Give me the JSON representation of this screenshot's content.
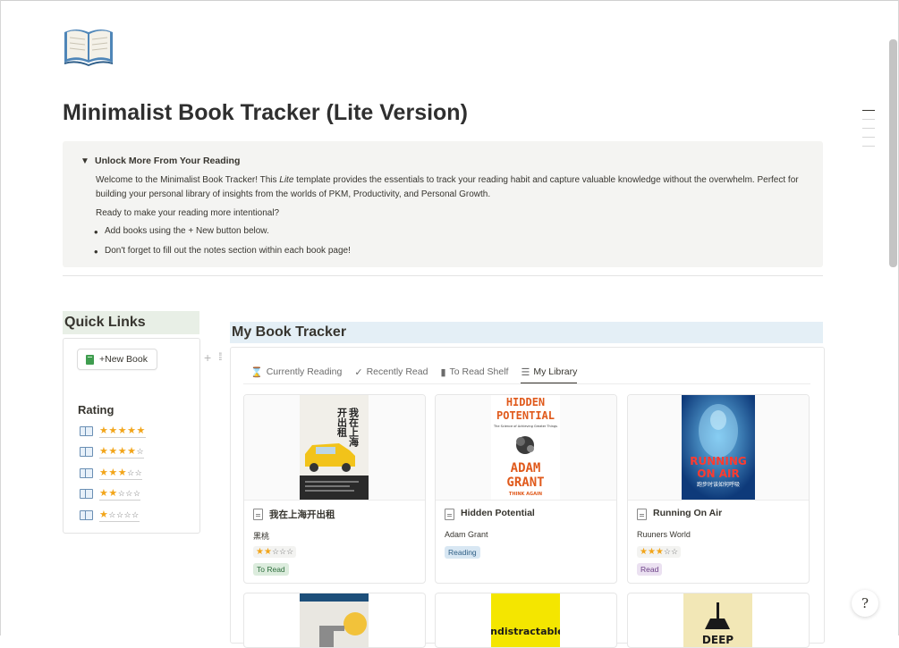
{
  "page": {
    "title": "Minimalist Book Tracker (Lite Version)",
    "icon": "open-book-icon"
  },
  "callout": {
    "toggle_label": "Unlock More From Your Reading",
    "intro_before_italic": "Welcome to the Minimalist Book Tracker! This ",
    "intro_italic": "Lite",
    "intro_after_italic": " template provides the essentials to track your reading habit and capture valuable knowledge without the overwhelm. Perfect for building your personal library of insights from the worlds of PKM, Productivity, and Personal Growth.",
    "question": "Ready to make your reading more intentional?",
    "bullets": [
      "Add books using the + New button below.",
      "Don't forget to fill out the notes section within each book page!"
    ]
  },
  "quick_links": {
    "heading": "Quick Links",
    "new_book_label": "+New Book",
    "rating_heading": "Rating",
    "ratings": [
      {
        "filled": 5,
        "empty": 0
      },
      {
        "filled": 4,
        "empty": 1
      },
      {
        "filled": 3,
        "empty": 2
      },
      {
        "filled": 2,
        "empty": 3
      },
      {
        "filled": 1,
        "empty": 4
      }
    ]
  },
  "tracker": {
    "heading": "My Book Tracker",
    "tabs": [
      {
        "label": "Currently Reading",
        "icon": "hourglass-icon",
        "glyph": "⌛",
        "active": false
      },
      {
        "label": "Recently Read",
        "icon": "checkmark-icon",
        "glyph": "✓",
        "active": false
      },
      {
        "label": "To Read Shelf",
        "icon": "book-icon",
        "glyph": "▮",
        "active": false
      },
      {
        "label": "My Library",
        "icon": "list-icon",
        "glyph": "☰",
        "active": true
      }
    ],
    "books": [
      {
        "title": "我在上海开出租",
        "author": "黑桃",
        "rating_filled": 2,
        "rating_empty": 3,
        "status": "To Read",
        "status_bg": "#dcecdd",
        "status_color": "#2f6f3e"
      },
      {
        "title": "Hidden Potential",
        "author": "Adam Grant",
        "rating_filled": 0,
        "rating_empty": 0,
        "status": "Reading",
        "status_bg": "#d8e7f3",
        "status_color": "#2f5f85"
      },
      {
        "title": "Running On Air",
        "author": "Ruuners World",
        "rating_filled": 3,
        "rating_empty": 2,
        "status": "Read",
        "status_bg": "#ebe1f1",
        "status_color": "#6b3f86"
      }
    ],
    "cover_text": {
      "book1_vertical_a": "我在上海",
      "book1_vertical_b": "开出租",
      "book2_line1": "HIDDEN",
      "book2_line2": "POTENTIAL",
      "book2_sub": "The Science of Achieving Greater Things",
      "book2_author_a": "ADAM",
      "book2_author_b": "GRANT",
      "book2_footer": "THINK AGAIN",
      "book3_line1": "RUNNING",
      "book3_line2": "ON AIR",
      "book3_sub": "跑步时该如何呼吸",
      "book5_title": "indistractable",
      "book6_title": "DEEP"
    }
  },
  "colors": {
    "quick_links_bg": "#e8efe6",
    "tracker_bg": "#e4eff6",
    "callout_bg": "#f4f4f2",
    "star": "#f2a51a"
  },
  "help_button_label": "?"
}
